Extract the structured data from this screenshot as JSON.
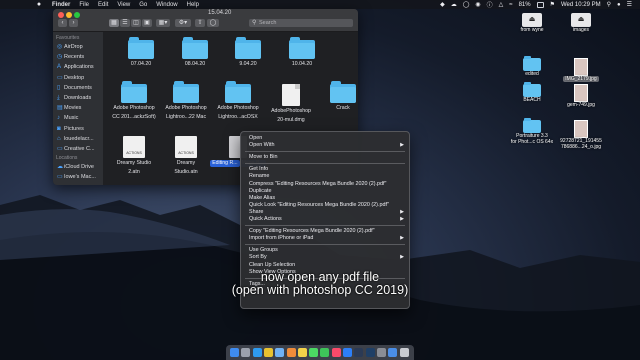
{
  "menubar": {
    "apple": "",
    "items": [
      "Finder",
      "File",
      "Edit",
      "View",
      "Go",
      "Window",
      "Help"
    ],
    "battery": "81%",
    "clock": "Wed 10:29 PM"
  },
  "finder": {
    "title": "15.04.20",
    "search_placeholder": "Search",
    "sidebar": {
      "favourites_header": "Favourites",
      "favourites": [
        {
          "label": "AirDrop",
          "icon": "airdrop-icon",
          "glyph": "◎"
        },
        {
          "label": "Recents",
          "icon": "clock-icon",
          "glyph": "◷"
        },
        {
          "label": "Applications",
          "icon": "applications-icon",
          "glyph": "A"
        },
        {
          "label": "Desktop",
          "icon": "desktop-icon",
          "glyph": "▭"
        },
        {
          "label": "Documents",
          "icon": "document-icon",
          "glyph": "▯"
        },
        {
          "label": "Downloads",
          "icon": "download-icon",
          "glyph": "⤓"
        },
        {
          "label": "Movies",
          "icon": "film-icon",
          "glyph": "▤"
        },
        {
          "label": "Music",
          "icon": "music-icon",
          "glyph": "♪"
        },
        {
          "label": "Pictures",
          "icon": "camera-icon",
          "glyph": "◙"
        },
        {
          "label": "louedelacr...",
          "icon": "home-icon",
          "glyph": "⌂"
        },
        {
          "label": "Creative C...",
          "icon": "folder-icon",
          "glyph": "▭"
        }
      ],
      "locations_header": "Locations",
      "locations": [
        {
          "label": "iCloud Drive",
          "icon": "cloud-icon",
          "glyph": "☁"
        },
        {
          "label": "Iowe's Mac...",
          "icon": "laptop-icon",
          "glyph": "▭"
        }
      ]
    },
    "items": [
      {
        "type": "folder",
        "label": [
          "07.04.20"
        ]
      },
      {
        "type": "folder",
        "label": [
          "08.04.20"
        ]
      },
      {
        "type": "folder",
        "label": [
          "9.04.20"
        ]
      },
      {
        "type": "folder",
        "label": [
          "10.04.20"
        ]
      },
      {
        "type": "folder",
        "label": [
          "Adobe Photoshop",
          "CC 201...ackzSoft)"
        ]
      },
      {
        "type": "folder",
        "label": [
          "Adobe Photoshop",
          "Lightroo...22 Mac"
        ]
      },
      {
        "type": "folder",
        "label": [
          "Adobe Photoshop",
          "Lightroo...acOSX"
        ]
      },
      {
        "type": "document",
        "label": [
          "AdobePhotoshop",
          "20-mul.dmg"
        ]
      },
      {
        "type": "folder",
        "label": [
          "Crack"
        ]
      },
      {
        "type": "actions",
        "badge": "ACTIONS",
        "label": [
          "Dreamy Studio",
          "2.atn"
        ]
      },
      {
        "type": "actions",
        "badge": "ACTIONS",
        "label": [
          "Dreamy",
          "Studio.atn"
        ]
      },
      {
        "type": "zip",
        "label": [
          "Editing R...",
          "Mega B..."
        ],
        "selected": true
      }
    ]
  },
  "context_menu": {
    "groups": [
      [
        {
          "label": "Open"
        },
        {
          "label": "Open With",
          "submenu": true
        }
      ],
      [
        {
          "label": "Move to Bin"
        }
      ],
      [
        {
          "label": "Get Info"
        },
        {
          "label": "Rename"
        },
        {
          "label": "Compress \"Editing Resources Mega Bundle 2020 (2).pdf\""
        },
        {
          "label": "Duplicate"
        },
        {
          "label": "Make Alias"
        },
        {
          "label": "Quick Look \"Editing Resources Mega Bundle 2020 (2).pdf\""
        },
        {
          "label": "Share",
          "submenu": true
        },
        {
          "label": "Quick Actions",
          "submenu": true
        }
      ],
      [
        {
          "label": "Copy \"Editing Resources Mega Bundle 2020 (2).pdf\""
        },
        {
          "label": "Import from iPhone or iPad",
          "submenu": true
        }
      ],
      [
        {
          "label": "Use Groups"
        },
        {
          "label": "Sort By",
          "submenu": true
        },
        {
          "label": "Clean Up Selection"
        },
        {
          "label": "Show View Options"
        }
      ],
      [
        {
          "label": "Tags..."
        }
      ]
    ]
  },
  "desktop_icons": [
    {
      "type": "drive",
      "label": [
        "from wyne"
      ]
    },
    {
      "type": "drive",
      "label": [
        "images"
      ]
    },
    {
      "type": "folder",
      "label": [
        "edited"
      ]
    },
    {
      "type": "image",
      "label": [
        "IMG_2179.jpg"
      ],
      "selected": true
    },
    {
      "type": "folder",
      "label": [
        "BEACH"
      ]
    },
    {
      "type": "image",
      "label": [
        "gem-749.jpg"
      ]
    },
    {
      "type": "folder",
      "label": [
        "Portraiture 3.3",
        "for Phot...c OS 64x"
      ]
    },
    {
      "type": "image",
      "label": [
        "92728721_191455",
        "786886...24_o.jpg"
      ]
    }
  ],
  "caption": {
    "line1": "now open any pdf file",
    "line2": "(open with photoshop CC 2019)"
  },
  "colors": {
    "accent": "#2a62d9",
    "folder": "#62c3f2",
    "close": "#fc5f57",
    "minimize": "#fdbc2e",
    "zoom": "#28c840"
  },
  "dock_apps": [
    {
      "name": "finder-icon",
      "color": "#3f8cf0"
    },
    {
      "name": "launchpad-icon",
      "color": "#9aa0ad"
    },
    {
      "name": "safari-icon",
      "color": "#2e9bf0"
    },
    {
      "name": "chrome-icon",
      "color": "#e8c230"
    },
    {
      "name": "mail-icon",
      "color": "#6fb1f5"
    },
    {
      "name": "photos-icon",
      "color": "#f08c3a"
    },
    {
      "name": "notes-icon",
      "color": "#f3d24a"
    },
    {
      "name": "messages-icon",
      "color": "#4cd964"
    },
    {
      "name": "facetime-icon",
      "color": "#3ec45a"
    },
    {
      "name": "music-icon",
      "color": "#fa4a6a"
    },
    {
      "name": "app-store-icon",
      "color": "#2d7ff7"
    },
    {
      "name": "lightroom-icon",
      "color": "#2b3a55"
    },
    {
      "name": "photoshop-icon",
      "color": "#1f3f66"
    },
    {
      "name": "system-preferences-icon",
      "color": "#8a8d95"
    },
    {
      "name": "downloads-stack-icon",
      "color": "#4a8ee8"
    },
    {
      "name": "trash-icon",
      "color": "#c9ccd2"
    }
  ]
}
